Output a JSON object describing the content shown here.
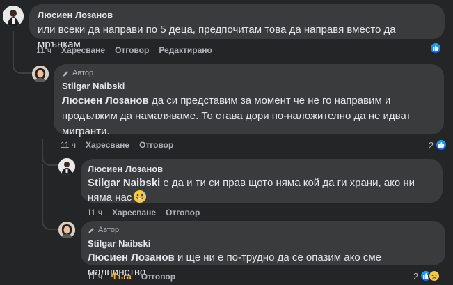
{
  "comments": [
    {
      "author": "Люсиен Лозанов",
      "is_author_badge": false,
      "text": "или всеки да направи по 5 деца, предпочитам това да направя вместо да мрънкам",
      "time": "11 ч",
      "actions": [
        "Харесване",
        "Отговор",
        "Редактирано"
      ]
    },
    {
      "badge": "Автор",
      "author": "Stilgar Naibski",
      "mention": "Люсиен Лозанов",
      "text": " да си представим за момент че не го направим и продължим да намаляваме. То става дори по-наложително да не идват мигранти.",
      "time": "11 ч",
      "actions": [
        "Харесване",
        "Отговор"
      ],
      "reaction_count": "2"
    },
    {
      "author": "Люсиен Лозанов",
      "mention": "Stilgar Naibski",
      "text": " е да и ти си прав щото няма кой да ги храни, ако ни няма нас",
      "time": "11 ч",
      "actions": [
        "Харесване",
        "Отговор"
      ]
    },
    {
      "badge": "Автор",
      "author": "Stilgar Naibski",
      "mention": "Люсиен Лозанов",
      "text": " и ще ни е по-трудно да се опазим ако сме малцинство",
      "time": "11 ч",
      "actions": [
        "Тъга",
        "Отговор"
      ],
      "reaction_count": "2"
    }
  ],
  "colors": {
    "background": "#242526",
    "bubble": "#3a3b3c",
    "text": "#e4e6eb",
    "muted": "#b0b3b8",
    "like_blue": "#0866ff",
    "sad_yellow": "#f7b928"
  },
  "icons": [
    "like-icon",
    "haha-icon",
    "sad-icon",
    "grin-sweat-emoji",
    "pencil-icon"
  ]
}
